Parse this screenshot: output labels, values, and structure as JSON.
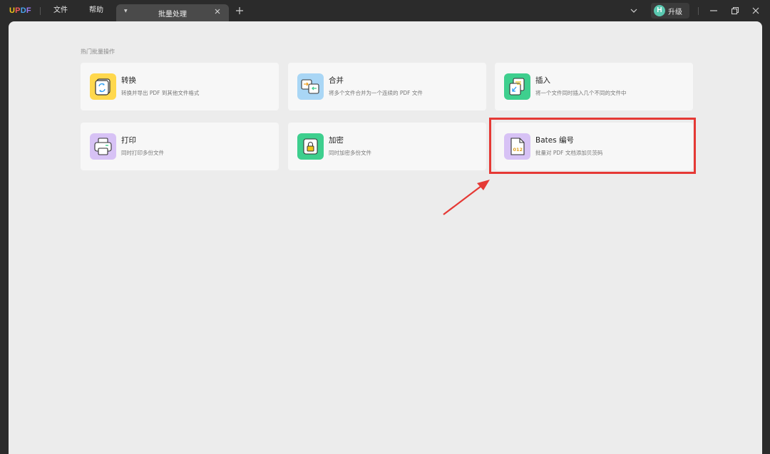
{
  "app": {
    "logo_text": "UPDF"
  },
  "menu": [
    {
      "label": "文件"
    },
    {
      "label": "帮助"
    }
  ],
  "tab": {
    "title": "批量处理"
  },
  "account": {
    "avatar_letter": "H",
    "upgrade_label": "升级"
  },
  "section": {
    "title": "热门批量操作"
  },
  "cards": [
    {
      "title": "转换",
      "description": "转换并导出 PDF 到其他文件格式",
      "icon": "convert-icon",
      "icon_bg": "#ffd84d"
    },
    {
      "title": "合并",
      "description": "将多个文件合并为一个连续的 PDF 文件",
      "icon": "merge-icon",
      "icon_bg": "#a9d6f5"
    },
    {
      "title": "插入",
      "description": "将一个文件同时插入几个不同的文件中",
      "icon": "insert-icon",
      "icon_bg": "#3ecf8e"
    },
    {
      "title": "打印",
      "description": "同时打印多份文件",
      "icon": "print-icon",
      "icon_bg": "#d7c2f5"
    },
    {
      "title": "加密",
      "description": "同时加密多份文件",
      "icon": "encrypt-icon",
      "icon_bg": "#3ecf8e"
    },
    {
      "title": "Bates 编号",
      "description": "批量对 PDF 文档添加贝茨码",
      "icon": "bates-number-icon",
      "icon_bg": "#d7c2f5"
    }
  ],
  "colors": {
    "highlight": "#e53935",
    "titlebar": "#2b2b2b",
    "panel": "#ececec",
    "card": "#f7f7f7"
  }
}
